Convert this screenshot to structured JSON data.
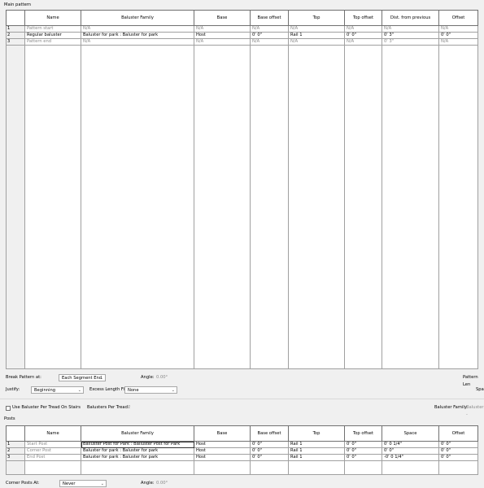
{
  "main_pattern": {
    "title": "Main pattern",
    "columns": [
      "",
      "Name",
      "Baluster Family",
      "Base",
      "Base offset",
      "Top",
      "Top offset",
      "Dist. from previous",
      "Offset"
    ],
    "rows": [
      {
        "num": "1",
        "name": "Pattern start",
        "family": "N/A",
        "base": "N/A",
        "base_offset": "N/A",
        "top": "N/A",
        "top_offset": "N/A",
        "dist": "N/A",
        "offset": "N/A",
        "gray": true
      },
      {
        "num": "2",
        "name": "Regular baluster",
        "family": "Baluster for park : Baluster for park",
        "base": "Host",
        "base_offset": "0'  0\"",
        "top": "Rail 1",
        "top_offset": "0'  0\"",
        "dist": "0'  3\"",
        "offset": "0'  0\"",
        "gray": false
      },
      {
        "num": "3",
        "name": "Pattern end",
        "family": "N/A",
        "base": "N/A",
        "base_offset": "N/A",
        "top": "N/A",
        "top_offset": "N/A",
        "dist": "0'  3\"",
        "offset": "N/A",
        "gray": true
      }
    ]
  },
  "pattern_controls": {
    "break_label": "Break Pattern at:",
    "break_value": "Each Segment End",
    "angle_label": "Angle:",
    "angle_value": "0.00°",
    "pattern_length_label": "Pattern Len",
    "justify_label": "Justify:",
    "justify_value": "Beginning",
    "excess_label": "Excess Length Fill :",
    "excess_value": "None",
    "spacing_label": "Spa"
  },
  "tread": {
    "checkbox_label": "Use Baluster Per Tread On Stairs",
    "per_tread_label": "Balusters Per Tread:",
    "per_tread_value": "2",
    "family_label": "Baluster Family:",
    "family_value": "Baluster -"
  },
  "posts": {
    "title": "Posts",
    "columns": [
      "",
      "Name",
      "Baluster Family",
      "Base",
      "Base offset",
      "Top",
      "Top offset",
      "Space",
      "Offset"
    ],
    "rows": [
      {
        "num": "1",
        "name": "Start Post",
        "family": "Balluster Post for Park : Balluster Post for Park",
        "base": "Host",
        "base_offset": "0'  0\"",
        "top": "Rail 1",
        "top_offset": "0'  0\"",
        "space": "0'  0 1/4\"",
        "offset": "0'  0\""
      },
      {
        "num": "2",
        "name": "Corner Post",
        "family": "Baluster for park : Baluster for park",
        "base": "Host",
        "base_offset": "0'  0\"",
        "top": "Rail 1",
        "top_offset": "0'  0\"",
        "space": "0'  0\"",
        "offset": "0'  0\""
      },
      {
        "num": "3",
        "name": "End Post",
        "family": "Baluster for park : Baluster for park",
        "base": "Host",
        "base_offset": "0'  0\"",
        "top": "Rail 1",
        "top_offset": "0'  0\"",
        "space": "-0'  0 1/4\"",
        "offset": "0'  0\""
      }
    ]
  },
  "corner": {
    "label": "Corner Posts At:",
    "value": "Never",
    "angle_label": "Angle:",
    "angle_value": "0.00°"
  }
}
